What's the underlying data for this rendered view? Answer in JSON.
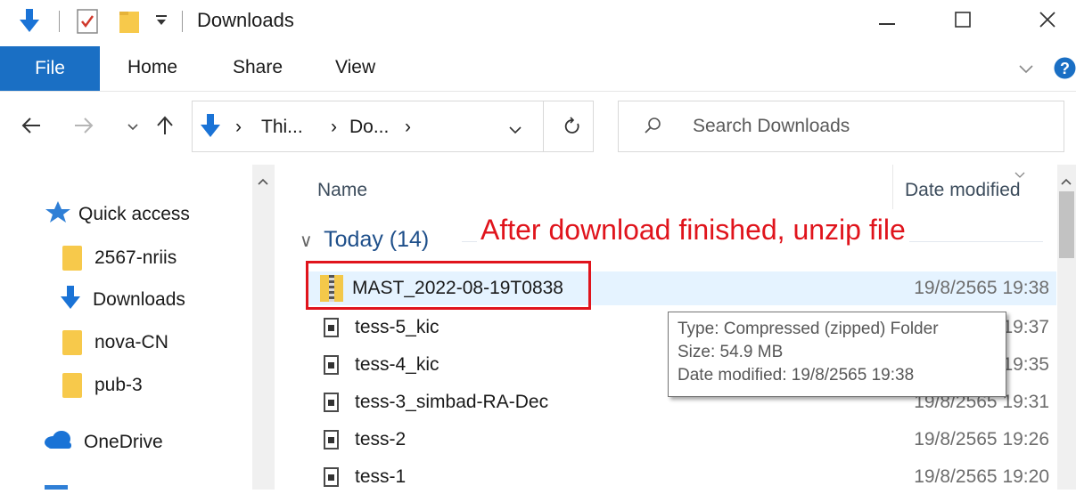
{
  "window": {
    "title": "Downloads",
    "controls": {
      "minimize": "minimize-icon",
      "maximize": "maximize-icon",
      "close": "close-icon"
    }
  },
  "ribbon": {
    "tabs": [
      "File",
      "Home",
      "Share",
      "View"
    ]
  },
  "address": {
    "crumbs": [
      "Thi...",
      "Do..."
    ],
    "search_placeholder": "Search Downloads"
  },
  "nav": {
    "quick_access": "Quick access",
    "items": [
      "2567-nriis",
      "Downloads",
      "nova-CN",
      "pub-3"
    ],
    "onedrive": "OneDrive"
  },
  "content": {
    "columns": {
      "name": "Name",
      "date": "Date modified"
    },
    "group": "Today (14)",
    "rows": [
      {
        "name": "MAST_2022-08-19T0838",
        "date": "19/8/2565 19:38"
      },
      {
        "name": "tess-5_kic",
        "date": "19:37"
      },
      {
        "name": "tess-4_kic",
        "date": "19:35"
      },
      {
        "name": "tess-3_simbad-RA-Dec",
        "date": "19/8/2565 19:31"
      },
      {
        "name": "tess-2",
        "date": "19/8/2565 19:26"
      },
      {
        "name": "tess-1",
        "date": "19/8/2565 19:20"
      }
    ]
  },
  "annotation": "After download finished, unzip file",
  "tooltip": {
    "type": "Type: Compressed (zipped) Folder",
    "size": "Size: 54.9 MB",
    "modified": "Date modified: 19/8/2565 19:38"
  },
  "colors": {
    "accent": "#1a6fc4",
    "annotation": "#e0141c",
    "selection": "#e5f3ff"
  }
}
